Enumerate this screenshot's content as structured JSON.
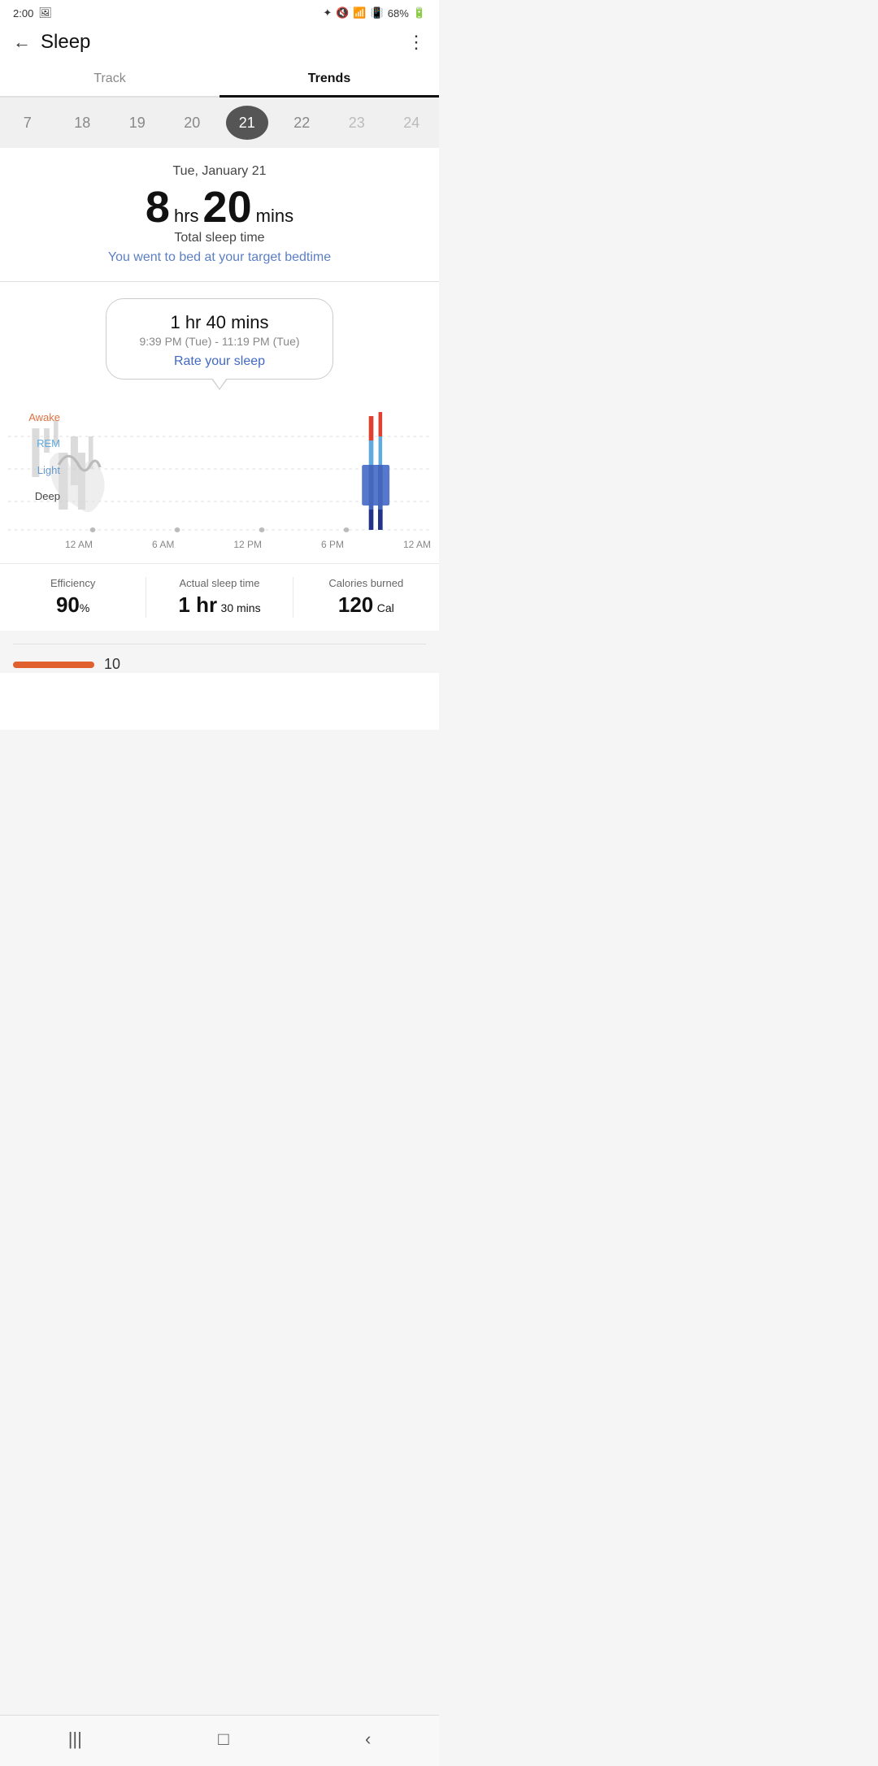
{
  "statusBar": {
    "time": "2:00",
    "battery": "68%"
  },
  "header": {
    "title": "Sleep",
    "backLabel": "←",
    "moreLabel": "⋮"
  },
  "tabs": [
    {
      "id": "track",
      "label": "Track",
      "active": false
    },
    {
      "id": "trends",
      "label": "Trends",
      "active": true
    }
  ],
  "dateSelector": {
    "items": [
      {
        "value": "7",
        "active": false
      },
      {
        "value": "18",
        "active": false
      },
      {
        "value": "19",
        "active": false
      },
      {
        "value": "20",
        "active": false
      },
      {
        "value": "21",
        "active": true
      },
      {
        "value": "22",
        "active": false
      },
      {
        "value": "23",
        "active": false
      },
      {
        "value": "24",
        "active": false
      }
    ]
  },
  "sleepSummary": {
    "dateLabel": "Tue, January 21",
    "hours": "8",
    "hrsUnit": "hrs",
    "minutes": "20",
    "minsUnit": "mins",
    "totalLabel": "Total sleep time",
    "targetMsg": "You went to bed at your target bedtime"
  },
  "sleepBubble": {
    "duration": "1 hr 40 mins",
    "timeRange": "9:39 PM (Tue) - 11:19 PM (Tue)",
    "rateLabel": "Rate your sleep"
  },
  "sleepChart": {
    "yLabels": [
      "Awake",
      "REM",
      "Light",
      "Deep"
    ],
    "xLabels": [
      "12 AM",
      "6 AM",
      "12 PM",
      "6 PM",
      "12 AM"
    ]
  },
  "statsRow": [
    {
      "id": "efficiency",
      "label": "Efficiency",
      "bigValue": "90",
      "unit": "%",
      "suffix": ""
    },
    {
      "id": "actual-sleep",
      "label": "Actual sleep time",
      "bigValue": "1 hr",
      "unit": "30 mins",
      "suffix": ""
    },
    {
      "id": "calories",
      "label": "Calories burned",
      "bigValue": "120",
      "unit": "Cal",
      "suffix": ""
    }
  ],
  "bottomBar": {
    "number": "10"
  },
  "navBar": {
    "menu": "|||",
    "home": "□",
    "back": "‹"
  }
}
